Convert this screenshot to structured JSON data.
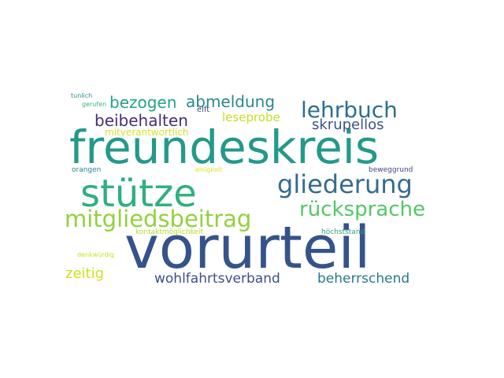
{
  "words": [
    {
      "text": "vorurteil",
      "color": "#35538b"
    },
    {
      "text": "freundeskreis",
      "color": "#23998a"
    },
    {
      "text": "stütze",
      "color": "#2fb07e"
    },
    {
      "text": "gliederung",
      "color": "#366b8f"
    },
    {
      "text": "mitgliedsbeitrag",
      "color": "#92d13e"
    },
    {
      "text": "rücksprache",
      "color": "#56c667"
    },
    {
      "text": "lehrbuch",
      "color": "#2c6f8e"
    },
    {
      "text": "bezogen",
      "color": "#23a08a"
    },
    {
      "text": "abmeldung",
      "color": "#29888e"
    },
    {
      "text": "beibehalten",
      "color": "#482e79"
    },
    {
      "text": "skrupellos",
      "color": "#3c518a"
    },
    {
      "text": "leseprobe",
      "color": "#c2df23"
    },
    {
      "text": "mitverantwortlich",
      "color": "#d6e22b"
    },
    {
      "text": "elft",
      "color": "#3d4b89"
    },
    {
      "text": "zeitig",
      "color": "#cde11d"
    },
    {
      "text": "wohlfahrtsverband",
      "color": "#3c508b"
    },
    {
      "text": "beherrschend",
      "color": "#2a788e"
    },
    {
      "text": "tunlich",
      "color": "#2b8a8e"
    },
    {
      "text": "gerufen",
      "color": "#36b477"
    },
    {
      "text": "orangen",
      "color": "#26828e"
    },
    {
      "text": "einigkeit",
      "color": "#e1e31c"
    },
    {
      "text": "beweggrund",
      "color": "#404688"
    },
    {
      "text": "kontaktmöglichkeit",
      "color": "#b0dc2a"
    },
    {
      "text": "höchststand",
      "color": "#2ea17c"
    },
    {
      "text": "denkwürdig",
      "color": "#c8e020"
    }
  ]
}
